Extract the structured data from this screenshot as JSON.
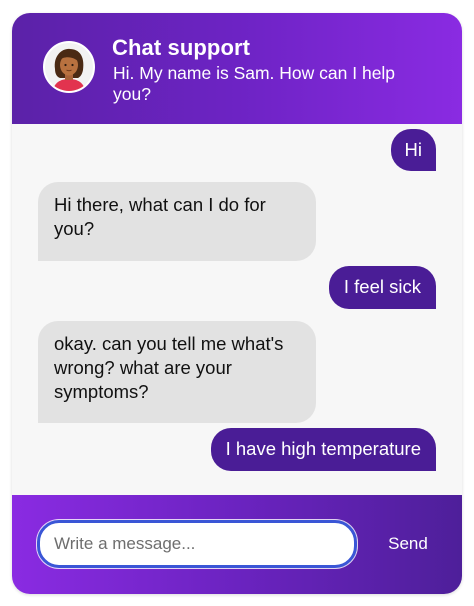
{
  "colors": {
    "header_gradient": [
      "#5b22a8",
      "#8a2be2"
    ],
    "user_bubble": "#4a1d96",
    "agent_bubble": "#e2e2e2",
    "input_border": "#3a56d6"
  },
  "header": {
    "title": "Chat support",
    "subtitle": "Hi. My name is Sam. How can I help you?",
    "avatar_icon": "support-agent-avatar"
  },
  "messages": [
    {
      "sender": "user",
      "text": "Hi"
    },
    {
      "sender": "agent",
      "text": "Hi there, what can I do for you?"
    },
    {
      "sender": "user",
      "text": "I feel sick"
    },
    {
      "sender": "agent",
      "text": "okay. can you tell me what's wrong? what are your symptoms?"
    },
    {
      "sender": "user",
      "text": "I have high temperature"
    }
  ],
  "composer": {
    "placeholder": "Write a message...",
    "value": "",
    "send_label": "Send"
  }
}
